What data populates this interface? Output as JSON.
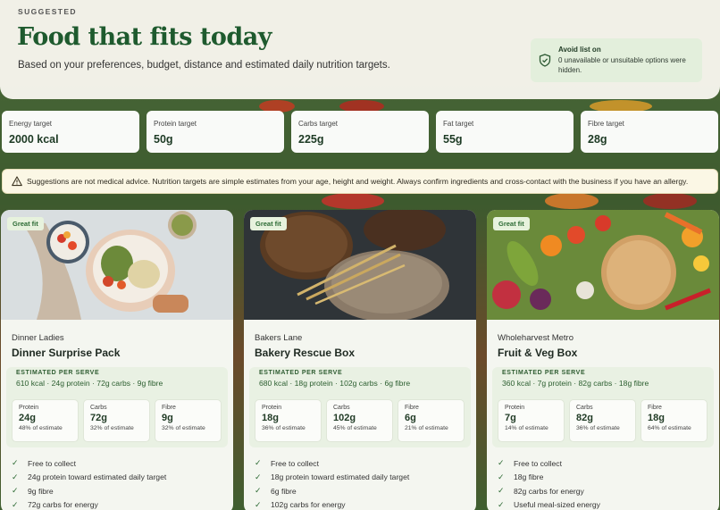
{
  "hero": {
    "eyebrow": "SUGGESTED",
    "title": "Food that fits today",
    "subtitle": "Based on your preferences, budget, distance and estimated daily nutrition targets.",
    "avoid_title": "Avoid list on",
    "avoid_text": "0 unavailable or unsuitable options were hidden.",
    "avoid_icon": "shield-check-icon"
  },
  "targets": [
    {
      "label": "Energy target",
      "value": "2000 kcal"
    },
    {
      "label": "Protein target",
      "value": "50g"
    },
    {
      "label": "Carbs target",
      "value": "225g"
    },
    {
      "label": "Fat target",
      "value": "55g"
    },
    {
      "label": "Fibre target",
      "value": "28g"
    }
  ],
  "notice": {
    "icon": "warning-triangle-icon",
    "text": "Suggestions are not medical advice. Nutrition targets are simple estimates from your age, height and weight. Always confirm ingredients and cross-contact with the business if you have an allergy."
  },
  "cards": [
    {
      "badge": "Great fit",
      "brand": "Dinner Ladies",
      "name": "Dinner Surprise Pack",
      "est_label": "ESTIMATED PER SERVE",
      "est_value": "610 kcal · 24g protein · 72g carbs · 9g fibre",
      "macros": [
        {
          "label": "Protein",
          "value": "24g",
          "pct": "48% of estimate"
        },
        {
          "label": "Carbs",
          "value": "72g",
          "pct": "32% of estimate"
        },
        {
          "label": "Fibre",
          "value": "9g",
          "pct": "32% of estimate"
        }
      ],
      "benefits": [
        "Free to collect",
        "24g protein toward estimated daily target",
        "9g fibre",
        "72g carbs for energy"
      ]
    },
    {
      "badge": "Great fit",
      "brand": "Bakers Lane",
      "name": "Bakery Rescue Box",
      "est_label": "ESTIMATED PER SERVE",
      "est_value": "680 kcal · 18g protein · 102g carbs · 6g fibre",
      "macros": [
        {
          "label": "Protein",
          "value": "18g",
          "pct": "36% of estimate"
        },
        {
          "label": "Carbs",
          "value": "102g",
          "pct": "45% of estimate"
        },
        {
          "label": "Fibre",
          "value": "6g",
          "pct": "21% of estimate"
        }
      ],
      "benefits": [
        "Free to collect",
        "18g protein toward estimated daily target",
        "6g fibre",
        "102g carbs for energy"
      ]
    },
    {
      "badge": "Great fit",
      "brand": "Wholeharvest Metro",
      "name": "Fruit & Veg Box",
      "est_label": "ESTIMATED PER SERVE",
      "est_value": "360 kcal · 7g protein · 82g carbs · 18g fibre",
      "macros": [
        {
          "label": "Protein",
          "value": "7g",
          "pct": "14% of estimate"
        },
        {
          "label": "Carbs",
          "value": "82g",
          "pct": "36% of estimate"
        },
        {
          "label": "Fibre",
          "value": "18g",
          "pct": "64% of estimate"
        }
      ],
      "benefits": [
        "Free to collect",
        "18g fibre",
        "82g carbs for energy",
        "Useful meal-sized energy"
      ]
    }
  ],
  "colors": {
    "brand_green": "#1e5a2e",
    "badge_bg": "#e7f2dd",
    "notice_bg": "#fbf7e5"
  }
}
